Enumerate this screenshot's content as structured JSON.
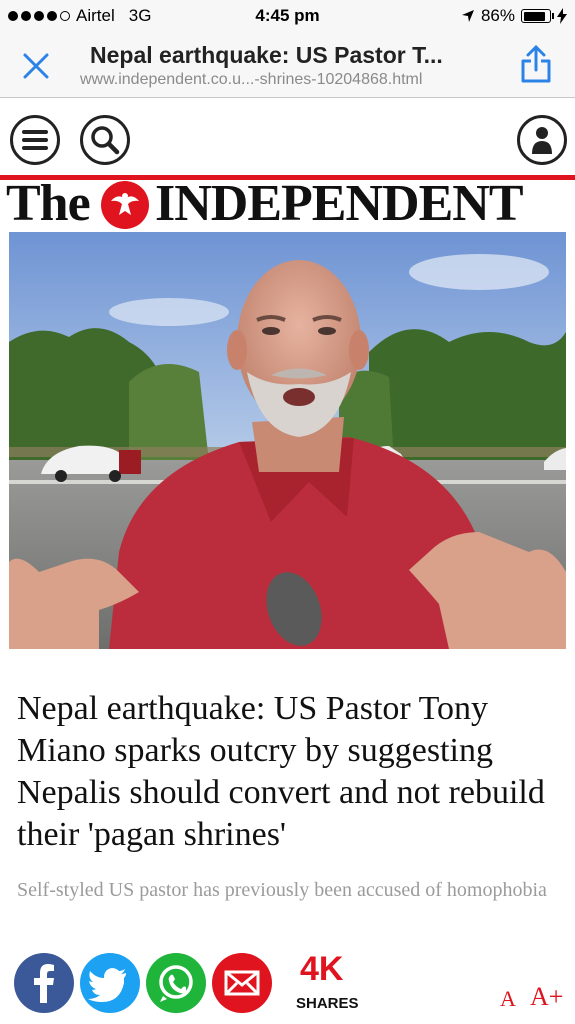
{
  "status_bar": {
    "carrier": "Airtel",
    "network": "3G",
    "time": "4:45 pm",
    "battery": "86%",
    "battery_level": 0.86
  },
  "browser": {
    "page_title": "Nepal earthquake: US Pastor T...",
    "url": "www.independent.co.u...-shrines-10204868.html",
    "close_icon": "close-icon",
    "share_icon": "share-icon"
  },
  "site_nav": {
    "menu_icon": "hamburger-menu-icon",
    "search_icon": "search-icon",
    "account_icon": "user-icon"
  },
  "logo": {
    "the": "The",
    "name": "INDEPENDENT",
    "brand_color": "#e0141e"
  },
  "article": {
    "headline": "Nepal earthquake: US Pastor Tony Miano sparks outcry by suggesting Nepalis should convert and not rebuild their 'pagan shrines'",
    "standfirst": "Self-styled US pastor has previously been accused of homophobia"
  },
  "share": {
    "count": "4K",
    "label": "SHARES",
    "buttons": [
      "facebook-icon",
      "twitter-icon",
      "whatsapp-icon",
      "email-icon"
    ]
  },
  "font_size": {
    "smaller": "A",
    "larger": "A+"
  }
}
